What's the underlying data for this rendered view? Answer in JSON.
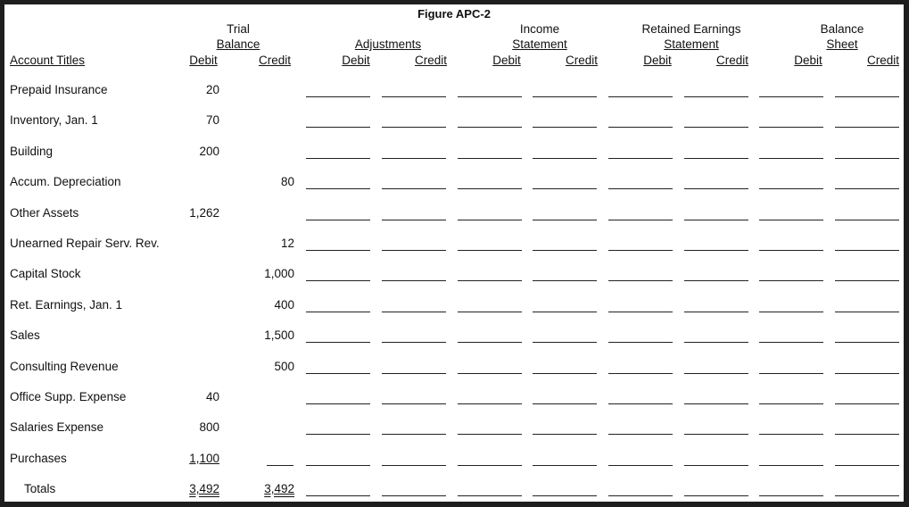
{
  "title": "Figure APC-2",
  "headers": {
    "account_titles": "Account Titles",
    "groups": [
      {
        "line1": "Trial",
        "line2": "Balance"
      },
      {
        "line1": "",
        "line2": "Adjustments"
      },
      {
        "line1": "Income",
        "line2": "Statement"
      },
      {
        "line1": "Retained Earnings",
        "line2": "Statement"
      },
      {
        "line1": "Balance",
        "line2": "Sheet"
      }
    ],
    "debit": "Debit",
    "credit": "Credit"
  },
  "rows": [
    {
      "account": "Prepaid Insurance",
      "debit": "20",
      "credit": ""
    },
    {
      "account": "Inventory, Jan. 1",
      "debit": "70",
      "credit": ""
    },
    {
      "account": "Building",
      "debit": "200",
      "credit": ""
    },
    {
      "account": "Accum. Depreciation",
      "debit": "",
      "credit": "80"
    },
    {
      "account": "Other Assets",
      "debit": "1,262",
      "credit": ""
    },
    {
      "account": "Unearned Repair Serv. Rev.",
      "debit": "",
      "credit": "12"
    },
    {
      "account": "Capital Stock",
      "debit": "",
      "credit": "1,000"
    },
    {
      "account": "Ret. Earnings, Jan. 1",
      "debit": "",
      "credit": "400"
    },
    {
      "account": "Sales",
      "debit": "",
      "credit": "1,500"
    },
    {
      "account": "Consulting Revenue",
      "debit": "",
      "credit": "500"
    },
    {
      "account": "Office Supp. Expense",
      "debit": "40",
      "credit": ""
    },
    {
      "account": "Salaries Expense",
      "debit": "800",
      "credit": ""
    },
    {
      "account": "Purchases",
      "debit": "1,100",
      "credit": ""
    }
  ],
  "totals": {
    "label": "Totals",
    "debit": "3,492",
    "credit": "3,492"
  }
}
